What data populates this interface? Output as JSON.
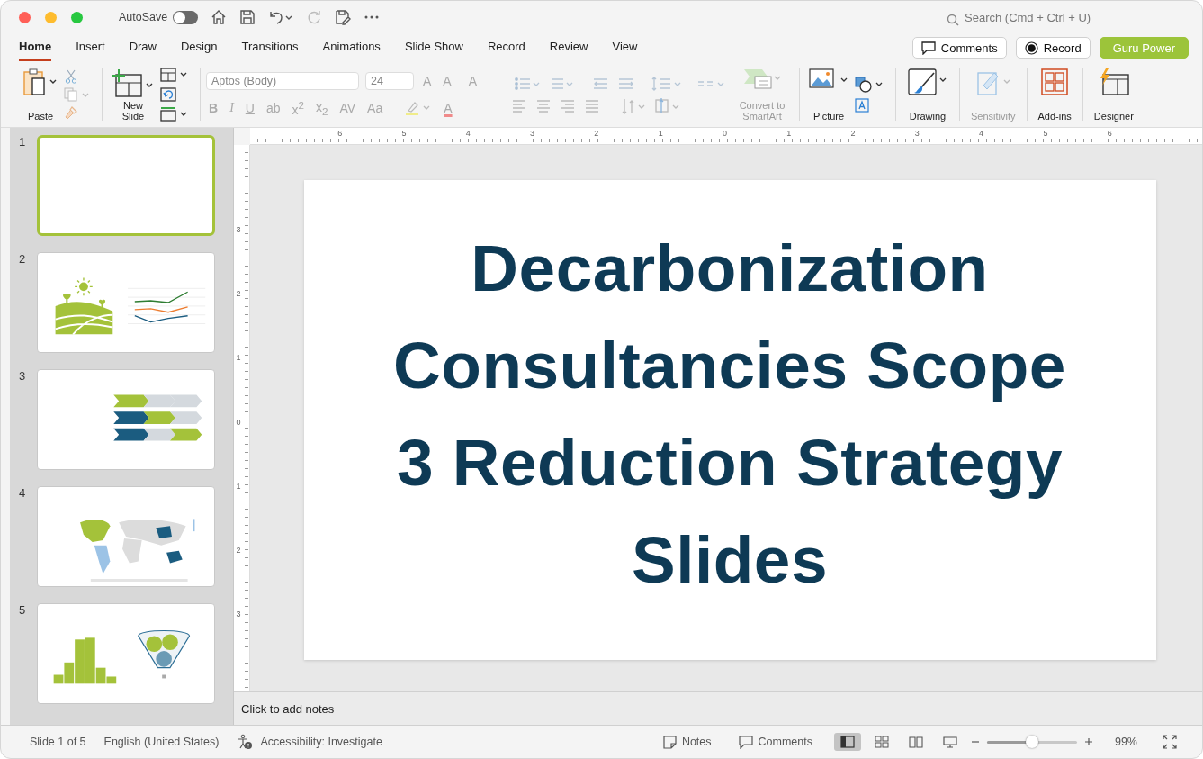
{
  "window": {
    "autosave_label": "AutoSave",
    "autosave_on": false,
    "search_placeholder": "Search (Cmd + Ctrl + U)"
  },
  "tabs": [
    {
      "label": "Home",
      "selected": true
    },
    {
      "label": "Insert",
      "selected": false
    },
    {
      "label": "Draw",
      "selected": false
    },
    {
      "label": "Design",
      "selected": false
    },
    {
      "label": "Transitions",
      "selected": false
    },
    {
      "label": "Animations",
      "selected": false
    },
    {
      "label": "Slide Show",
      "selected": false
    },
    {
      "label": "Record",
      "selected": false
    },
    {
      "label": "Review",
      "selected": false
    },
    {
      "label": "View",
      "selected": false
    }
  ],
  "header_buttons": [
    {
      "kind": "comments",
      "label": "Comments"
    },
    {
      "kind": "record",
      "label": "Record"
    },
    {
      "kind": "accent",
      "label": "Guru Power"
    }
  ],
  "ribbon": {
    "large_buttons": [
      {
        "kind": "paste",
        "label": "Paste",
        "disabled": false
      },
      {
        "kind": "new_slide",
        "label": "New Slide",
        "disabled": false
      },
      {
        "kind": "smartart",
        "label": "Convert to SmartArt",
        "disabled": true
      },
      {
        "kind": "picture",
        "label": "Picture",
        "disabled": false
      },
      {
        "kind": "drawing",
        "label": "Drawing",
        "disabled": false
      },
      {
        "kind": "sensitivity",
        "label": "Sensitivity",
        "disabled": true
      },
      {
        "kind": "addins",
        "label": "Add-ins",
        "disabled": false
      },
      {
        "kind": "designer",
        "label": "Designer",
        "disabled": false
      }
    ],
    "font_name": "Aptos (Body)",
    "font_size": "24",
    "font_top": [
      {
        "kind": "grow",
        "label": "A",
        "disabled": true
      },
      {
        "kind": "shrink",
        "label": "A",
        "disabled": true
      },
      {
        "kind": "clear",
        "label": "A",
        "disabled": true
      }
    ],
    "font_bottom": [
      {
        "kind": "bold",
        "label": "B",
        "disabled": true
      },
      {
        "kind": "italic",
        "label": "I",
        "disabled": true
      },
      {
        "kind": "underline",
        "label": "U",
        "disabled": true
      },
      {
        "kind": "strike",
        "label": "ab",
        "disabled": true
      },
      {
        "kind": "superscript",
        "label": "x$^{2}$",
        "disabled": true
      },
      {
        "kind": "subscript",
        "label": "x$_{2}$",
        "disabled": true
      },
      {
        "kind": "spacing",
        "label": "AV",
        "disabled": true
      },
      {
        "kind": "case",
        "label": "Aa",
        "disabled": true
      },
      {
        "kind": "color",
        "label": "A",
        "disabled": true
      }
    ]
  },
  "slides": [
    {
      "number": "1",
      "kind": "blank",
      "selected": true
    },
    {
      "number": "2",
      "kind": "landscape_chart",
      "selected": false
    },
    {
      "number": "3",
      "kind": "chevrons",
      "selected": false
    },
    {
      "number": "4",
      "kind": "map",
      "selected": false
    },
    {
      "number": "5",
      "kind": "bars_funnel",
      "selected": false
    }
  ],
  "ruler": {
    "horizontal": [
      "6",
      "5",
      "4",
      "3",
      "2",
      "1",
      "0",
      "1",
      "2",
      "3",
      "4",
      "5",
      "6"
    ],
    "vertical": [
      "3",
      "2",
      "1",
      "0",
      "1",
      "2",
      "3"
    ]
  },
  "slide": {
    "title_lines": [
      "Decarbonization",
      "Consultancies Scope",
      "3 Reduction Strategy",
      "Slides"
    ]
  },
  "notes": {
    "placeholder": "Click to add notes"
  },
  "status_bar": {
    "slide_info": "Slide 1 of 5",
    "language": "English (United States)",
    "accessibility": "Accessibility: Investigate",
    "notes_label": "Notes",
    "comments_label": "Comments",
    "views": [
      {
        "kind": "normal",
        "selected": true
      },
      {
        "kind": "sorter",
        "selected": false
      },
      {
        "kind": "reading",
        "selected": false
      },
      {
        "kind": "presenter",
        "selected": false
      }
    ],
    "zoom": {
      "level": 0.5,
      "reading": "99%"
    }
  }
}
